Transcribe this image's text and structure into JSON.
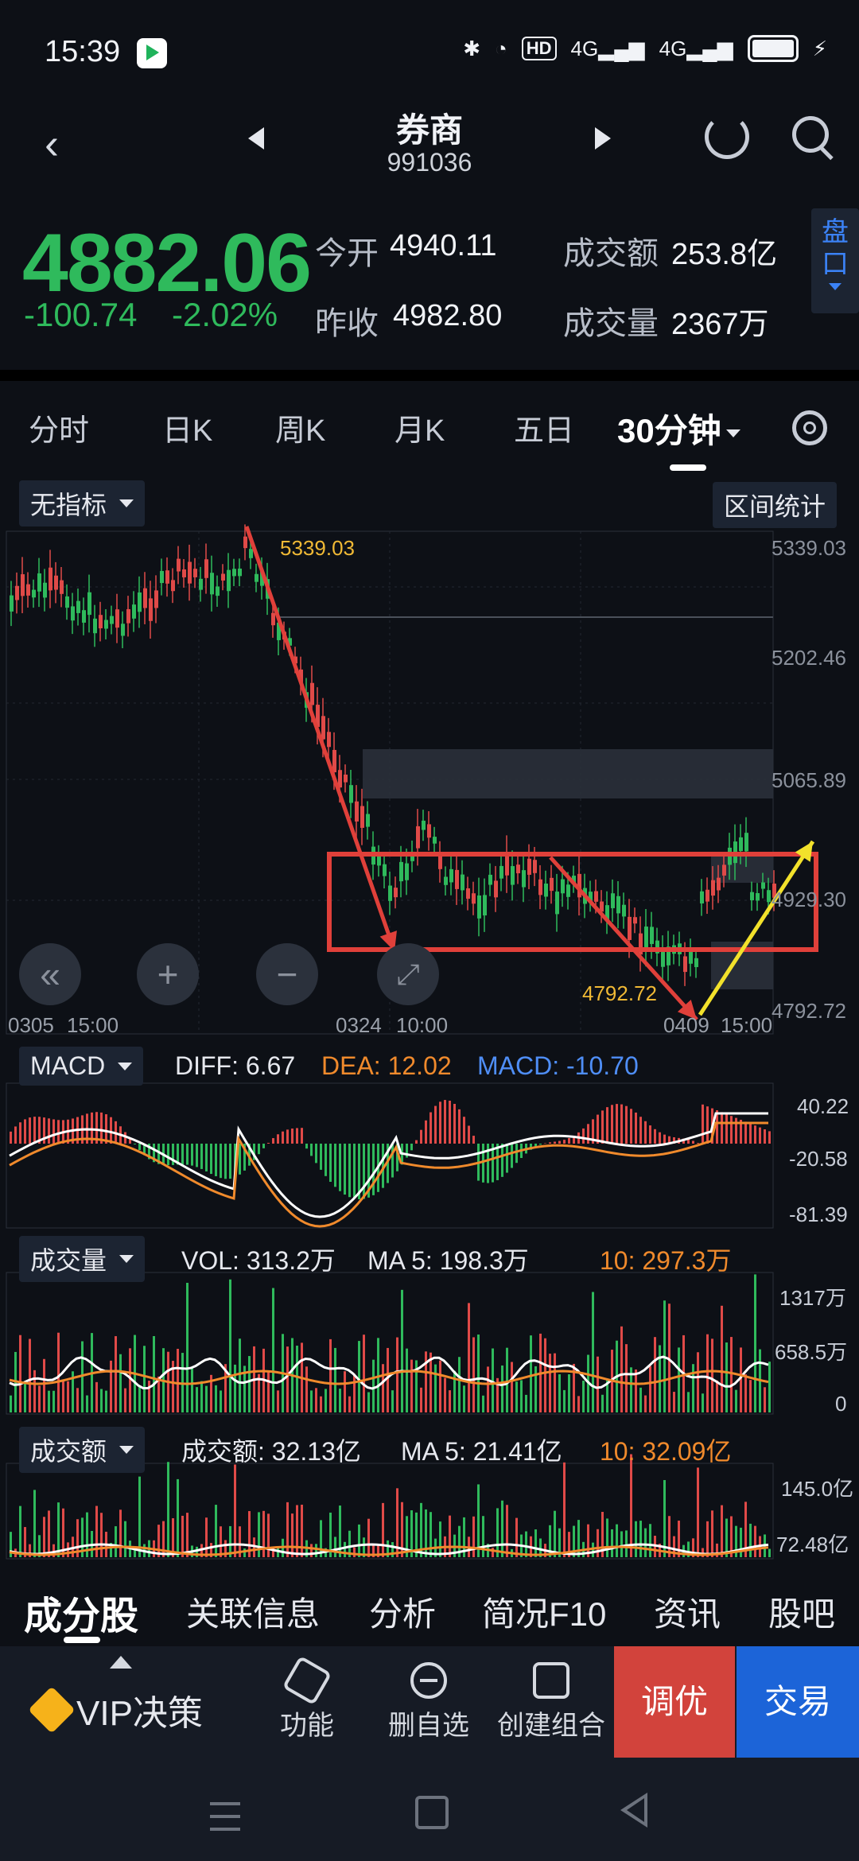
{
  "status": {
    "time": "15:39",
    "hd": "HD",
    "net1": "4G",
    "net2": "4G"
  },
  "header": {
    "title": "券商",
    "code": "991036"
  },
  "quote": {
    "price": "4882.06",
    "change": "-100.74",
    "change_pct": "-2.02%",
    "open_label": "今开",
    "open": "4940.11",
    "prev_label": "昨收",
    "prev": "4982.80",
    "amount_label": "成交额",
    "amount": "253.8亿",
    "volume_label": "成交量",
    "volume": "2367万",
    "pankou": "盘口"
  },
  "tabs": [
    "分时",
    "日K",
    "周K",
    "月K",
    "五日",
    "30分钟"
  ],
  "main_chart": {
    "indicator": "无指标",
    "range_stats": "区间统计",
    "y_labels": [
      "5339.03",
      "5202.46",
      "5065.89",
      "4929.30",
      "4792.72"
    ],
    "high_label": "5339.03",
    "low_label": "4792.72",
    "x_labels": [
      "0305",
      "15:00",
      "0324",
      "10:00",
      "0409",
      "15:00"
    ]
  },
  "macd": {
    "name": "MACD",
    "diff": "DIFF: 6.67",
    "dea": "DEA: 12.02",
    "macd": "MACD: -10.70",
    "y_labels": [
      "40.22",
      "-20.58",
      "-81.39"
    ]
  },
  "vol": {
    "name": "成交量",
    "vol": "VOL: 313.2万",
    "ma5": "MA 5: 198.3万",
    "ma10": "10: 297.3万",
    "y_labels": [
      "1317万",
      "658.5万",
      "0"
    ]
  },
  "amt": {
    "name": "成交额",
    "amt": "成交额: 32.13亿",
    "ma5": "MA 5: 21.41亿",
    "ma10": "10: 32.09亿",
    "y_labels": [
      "145.0亿",
      "72.48亿"
    ]
  },
  "bottom_tabs": [
    "成分股",
    "关联信息",
    "分析",
    "简况F10",
    "资讯",
    "股吧"
  ],
  "dock": {
    "vip": "VIP决策",
    "func": "功能",
    "del": "删自选",
    "combo": "创建组合",
    "tune": "调优",
    "trade": "交易"
  },
  "colors": {
    "up": "#e04a48",
    "down": "#2fba5c",
    "accent_yellow": "#f2e12b",
    "dea_orange": "#f08a2c",
    "macd_blue": "#4f8ef7"
  }
}
